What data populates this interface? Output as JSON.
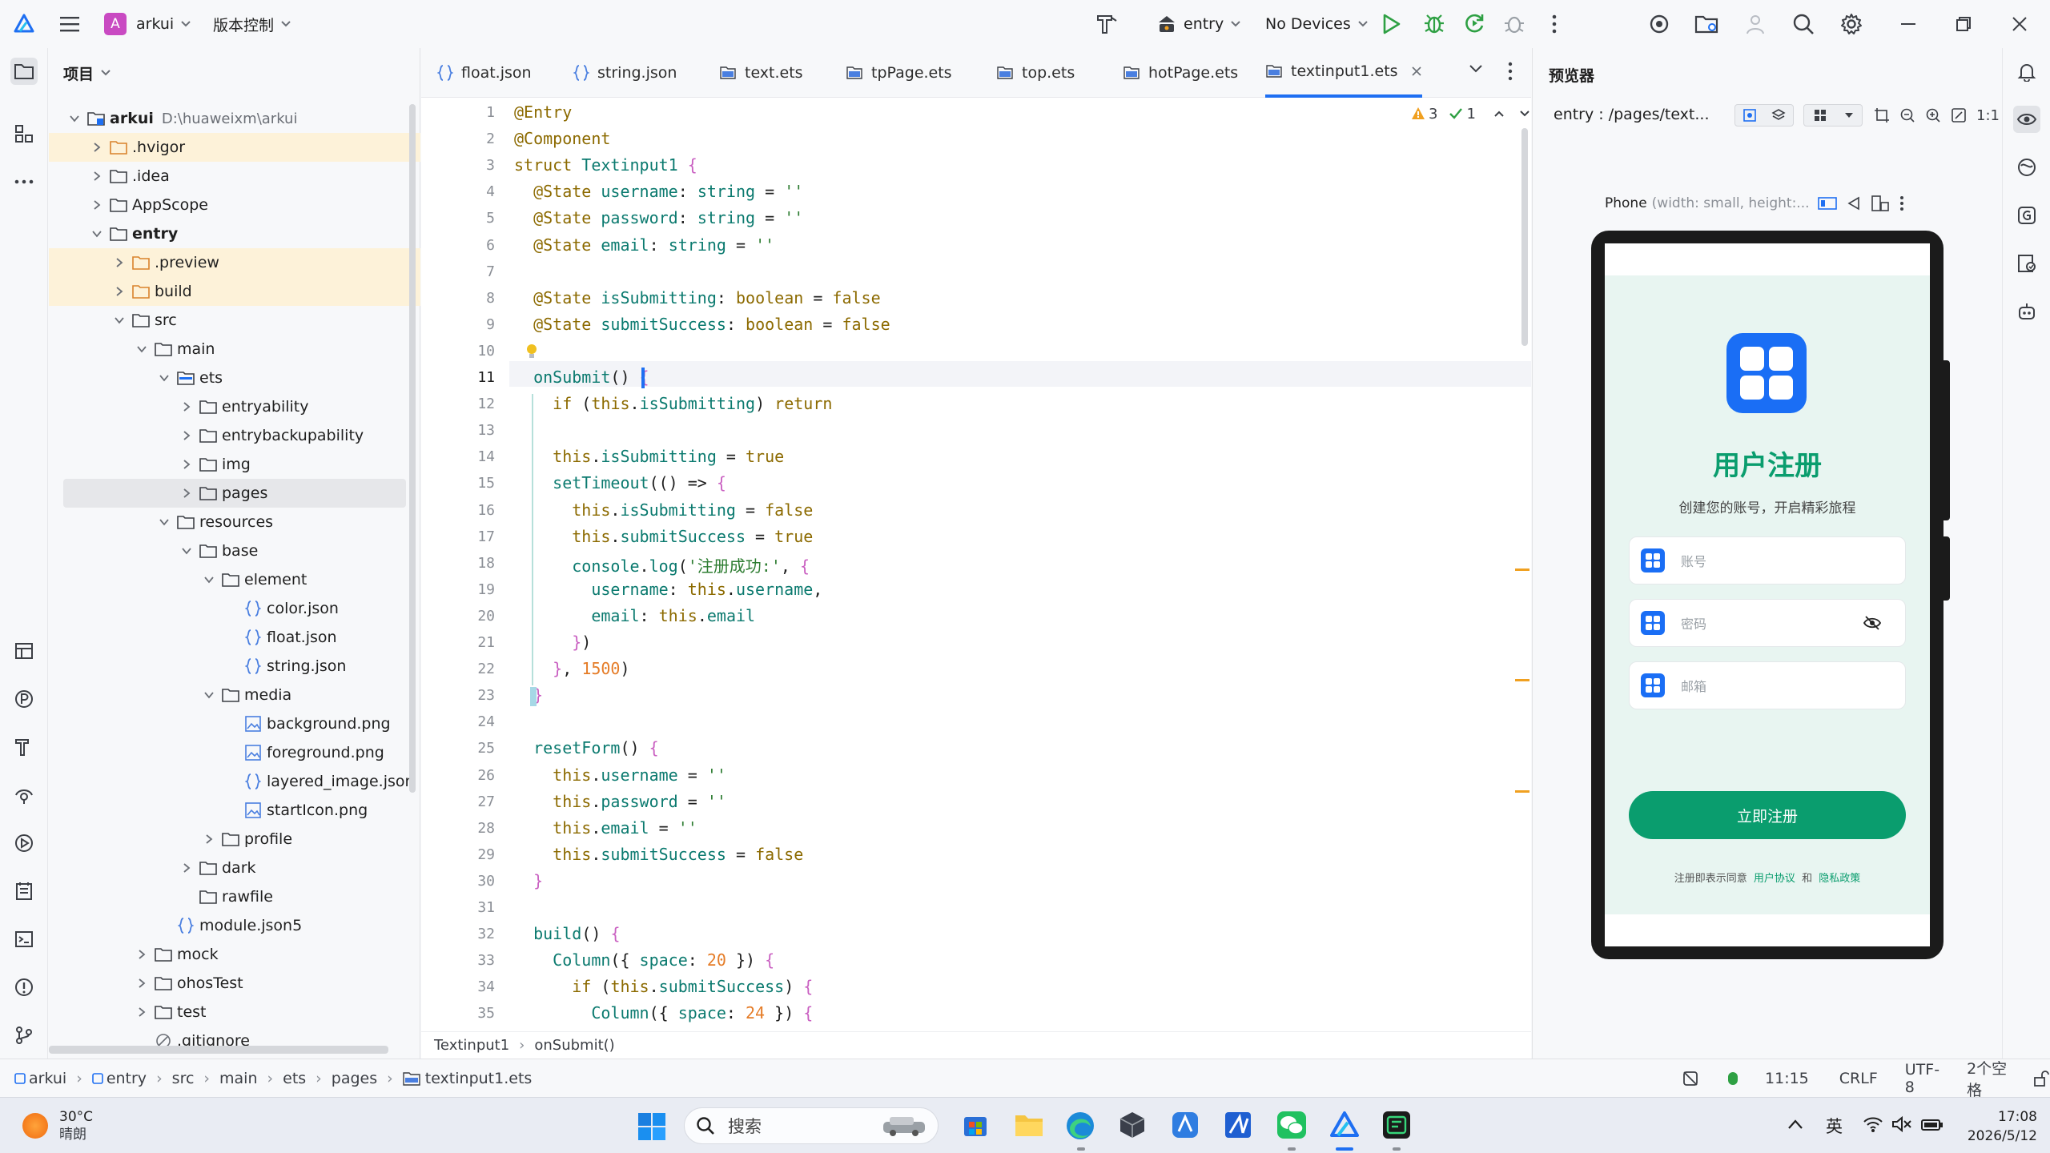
{
  "titlebar": {
    "project_name": "arkui",
    "project_letter": "A",
    "vcs_label": "版本控制",
    "run_target": "entry",
    "devices": "No Devices"
  },
  "project_panel": {
    "title": "项目",
    "items": [
      {
        "label": "arkui",
        "path": "D:\\huaweixm\\arkui",
        "depth": 0,
        "open": true,
        "type": "module",
        "bold": true
      },
      {
        "label": ".hvigor",
        "depth": 1,
        "open": false,
        "type": "folder-orange",
        "hl": true
      },
      {
        "label": ".idea",
        "depth": 1,
        "open": false,
        "type": "folder"
      },
      {
        "label": "AppScope",
        "depth": 1,
        "open": false,
        "type": "folder"
      },
      {
        "label": "entry",
        "depth": 1,
        "open": true,
        "type": "folder",
        "bold": true
      },
      {
        "label": ".preview",
        "depth": 2,
        "open": false,
        "type": "folder-orange",
        "hl": true
      },
      {
        "label": "build",
        "depth": 2,
        "open": false,
        "type": "folder-orange",
        "hl": true
      },
      {
        "label": "src",
        "depth": 2,
        "open": true,
        "type": "folder"
      },
      {
        "label": "main",
        "depth": 3,
        "open": true,
        "type": "folder"
      },
      {
        "label": "ets",
        "depth": 4,
        "open": true,
        "type": "folder-blue"
      },
      {
        "label": "entryability",
        "depth": 5,
        "open": false,
        "type": "folder"
      },
      {
        "label": "entrybackupability",
        "depth": 5,
        "open": false,
        "type": "folder"
      },
      {
        "label": "img",
        "depth": 5,
        "open": false,
        "type": "folder"
      },
      {
        "label": "pages",
        "depth": 5,
        "open": false,
        "type": "folder",
        "sel": true
      },
      {
        "label": "resources",
        "depth": 4,
        "open": true,
        "type": "folder"
      },
      {
        "label": "base",
        "depth": 5,
        "open": true,
        "type": "folder"
      },
      {
        "label": "element",
        "depth": 6,
        "open": true,
        "type": "folder"
      },
      {
        "label": "color.json",
        "depth": 7,
        "type": "json"
      },
      {
        "label": "float.json",
        "depth": 7,
        "type": "json"
      },
      {
        "label": "string.json",
        "depth": 7,
        "type": "json"
      },
      {
        "label": "media",
        "depth": 6,
        "open": true,
        "type": "folder"
      },
      {
        "label": "background.png",
        "depth": 7,
        "type": "image"
      },
      {
        "label": "foreground.png",
        "depth": 7,
        "type": "image"
      },
      {
        "label": "layered_image.json",
        "depth": 7,
        "type": "json"
      },
      {
        "label": "startIcon.png",
        "depth": 7,
        "type": "image"
      },
      {
        "label": "profile",
        "depth": 6,
        "open": false,
        "type": "folder"
      },
      {
        "label": "dark",
        "depth": 5,
        "open": false,
        "type": "folder"
      },
      {
        "label": "rawfile",
        "depth": 5,
        "type": "folder",
        "nochev": true
      },
      {
        "label": "module.json5",
        "depth": 4,
        "type": "json"
      },
      {
        "label": "mock",
        "depth": 3,
        "open": false,
        "type": "folder"
      },
      {
        "label": "ohosTest",
        "depth": 3,
        "open": false,
        "type": "folder"
      },
      {
        "label": "test",
        "depth": 3,
        "open": false,
        "type": "folder"
      },
      {
        "label": ".gitignore",
        "depth": 3,
        "type": "ignore",
        "nochev": true
      }
    ]
  },
  "tabs": [
    {
      "label": "float.json",
      "type": "json"
    },
    {
      "label": "string.json",
      "type": "json"
    },
    {
      "label": "text.ets",
      "type": "ets"
    },
    {
      "label": "tpPage.ets",
      "type": "ets"
    },
    {
      "label": "top.ets",
      "type": "ets"
    },
    {
      "label": "hotPage.ets",
      "type": "ets"
    },
    {
      "label": "textinput1.ets",
      "type": "ets",
      "active": true
    }
  ],
  "inspections": {
    "warnings": "3",
    "ok": "1"
  },
  "code_breadcrumb": {
    "struct": "Textinput1",
    "method": "onSubmit()"
  },
  "preview": {
    "title": "预览器",
    "path": "entry : /pages/text...",
    "scale": "1:1",
    "device_label": "Phone",
    "device_desc": "(width: small, height:...",
    "app": {
      "title": "用户注册",
      "subtitle": "创建您的账号，开启精彩旅程",
      "username_placeholder": "账号",
      "password_placeholder": "密码",
      "email_placeholder": "邮箱",
      "submit": "立即注册",
      "footer_prefix": "注册即表示同意",
      "footer_link1": "用户协议",
      "footer_and": "和",
      "footer_link2": "隐私政策",
      "accent": "#0a9d6e"
    }
  },
  "statusbar": {
    "crumbs": [
      "arkui",
      "entry",
      "src",
      "main",
      "ets",
      "pages",
      "textinput1.ets"
    ],
    "position": "11:15",
    "line_sep": "CRLF",
    "encoding": "UTF-8",
    "indent": "2个空格"
  },
  "taskbar": {
    "weather_temp": "30°C",
    "weather_desc": "晴朗",
    "search": "搜索",
    "ime": "英",
    "time": "17:08",
    "date": "2026/5/12"
  }
}
